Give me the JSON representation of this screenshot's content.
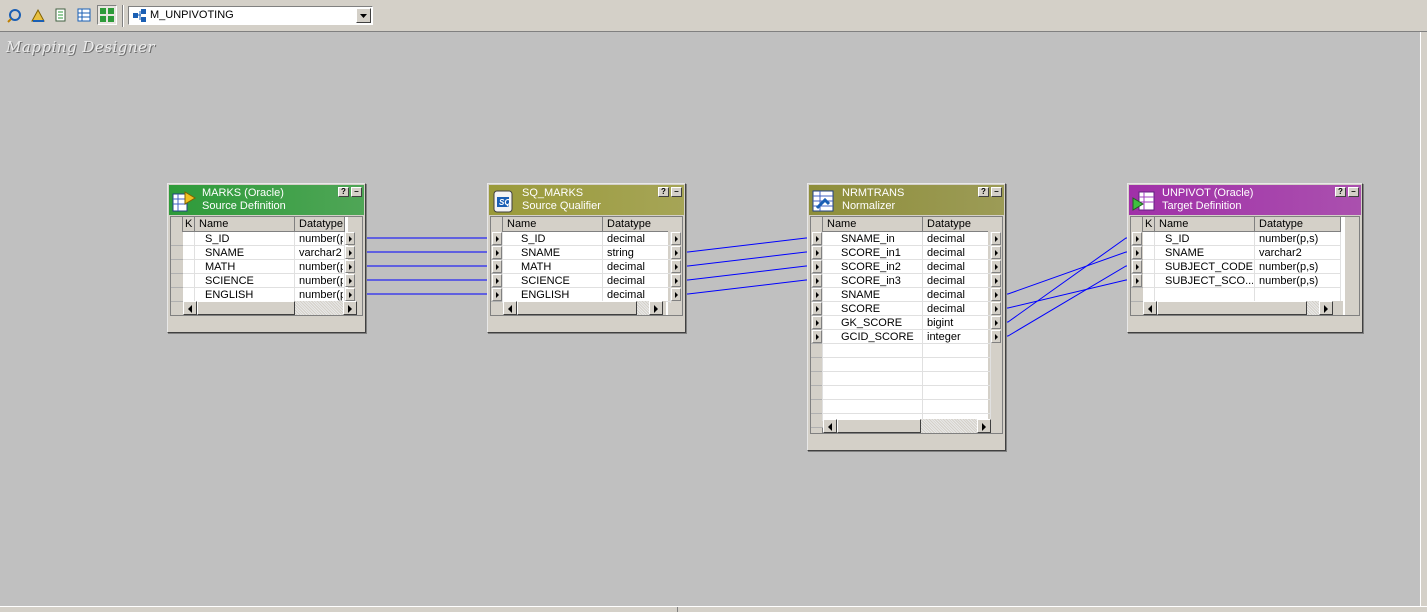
{
  "toolbar": {
    "buttons": [
      {
        "icon": "source-analyzer-icon"
      },
      {
        "icon": "target-designer-icon"
      },
      {
        "icon": "transformation-developer-icon"
      },
      {
        "icon": "mapplet-designer-icon"
      },
      {
        "icon": "mapping-designer-icon",
        "active": true
      }
    ],
    "mapping_select": {
      "value": "M_UNPIVOTING"
    }
  },
  "workspace": {
    "title": "Mapping Designer"
  },
  "colors": {
    "source_header": "#2e9b3a",
    "qualifier_header": "#9a9a3a",
    "normalizer_header": "#8e8e3a",
    "target_header": "#a030a8",
    "link_color": "#0000ff",
    "workspace_bg": "#c0c0c0"
  },
  "transformations": [
    {
      "id": "marks",
      "icon": "source-definition-icon",
      "name": "MARKS (Oracle)",
      "type": "Source Definition",
      "columns": {
        "key": "K",
        "name": "Name",
        "datatype": "Datatype"
      },
      "ports": [
        {
          "name": "S_ID",
          "datatype": "number(p"
        },
        {
          "name": "SNAME",
          "datatype": "varchar2"
        },
        {
          "name": "MATH",
          "datatype": "number(p"
        },
        {
          "name": "SCIENCE",
          "datatype": "number(p"
        },
        {
          "name": "ENGLISH",
          "datatype": "number(p"
        }
      ]
    },
    {
      "id": "sq_marks",
      "icon": "source-qualifier-icon",
      "name": "SQ_MARKS",
      "type": "Source Qualifier",
      "columns": {
        "name": "Name",
        "datatype": "Datatype"
      },
      "ports": [
        {
          "name": "S_ID",
          "datatype": "decimal"
        },
        {
          "name": "SNAME",
          "datatype": "string"
        },
        {
          "name": "MATH",
          "datatype": "decimal"
        },
        {
          "name": "SCIENCE",
          "datatype": "decimal"
        },
        {
          "name": "ENGLISH",
          "datatype": "decimal"
        }
      ]
    },
    {
      "id": "nrmtrans",
      "icon": "normalizer-icon",
      "name": "NRMTRANS",
      "type": "Normalizer",
      "columns": {
        "name": "Name",
        "datatype": "Datatype"
      },
      "ports": [
        {
          "name": "SNAME_in",
          "datatype": "decimal"
        },
        {
          "name": "SCORE_in1",
          "datatype": "decimal"
        },
        {
          "name": "SCORE_in2",
          "datatype": "decimal"
        },
        {
          "name": "SCORE_in3",
          "datatype": "decimal"
        },
        {
          "name": "SNAME",
          "datatype": "decimal"
        },
        {
          "name": "SCORE",
          "datatype": "decimal"
        },
        {
          "name": "GK_SCORE",
          "datatype": "bigint"
        },
        {
          "name": "GCID_SCORE",
          "datatype": "integer"
        }
      ]
    },
    {
      "id": "unpivot",
      "icon": "target-definition-icon",
      "name": "UNPIVOT (Oracle)",
      "type": "Target Definition",
      "columns": {
        "key": "K",
        "name": "Name",
        "datatype": "Datatype"
      },
      "ports": [
        {
          "name": "S_ID",
          "datatype": "number(p,s)"
        },
        {
          "name": "SNAME",
          "datatype": "varchar2"
        },
        {
          "name": "SUBJECT_CODE",
          "datatype": "number(p,s)"
        },
        {
          "name": "SUBJECT_SCO...",
          "datatype": "number(p,s)"
        }
      ]
    }
  ],
  "links": [
    {
      "from": "marks",
      "from_port": 0,
      "to": "sq_marks",
      "to_port": 0
    },
    {
      "from": "marks",
      "from_port": 1,
      "to": "sq_marks",
      "to_port": 1
    },
    {
      "from": "marks",
      "from_port": 2,
      "to": "sq_marks",
      "to_port": 2
    },
    {
      "from": "marks",
      "from_port": 3,
      "to": "sq_marks",
      "to_port": 3
    },
    {
      "from": "marks",
      "from_port": 4,
      "to": "sq_marks",
      "to_port": 4
    },
    {
      "from": "sq_marks",
      "from_port": 1,
      "to": "nrmtrans",
      "to_port": 0
    },
    {
      "from": "sq_marks",
      "from_port": 2,
      "to": "nrmtrans",
      "to_port": 1
    },
    {
      "from": "sq_marks",
      "from_port": 3,
      "to": "nrmtrans",
      "to_port": 2
    },
    {
      "from": "sq_marks",
      "from_port": 4,
      "to": "nrmtrans",
      "to_port": 3
    },
    {
      "from": "nrmtrans",
      "from_port": 4,
      "to": "unpivot",
      "to_port": 1
    },
    {
      "from": "nrmtrans",
      "from_port": 5,
      "to": "unpivot",
      "to_port": 3
    },
    {
      "from": "nrmtrans",
      "from_port": 6,
      "to": "unpivot",
      "to_port": 0
    },
    {
      "from": "nrmtrans",
      "from_port": 7,
      "to": "unpivot",
      "to_port": 2
    }
  ]
}
